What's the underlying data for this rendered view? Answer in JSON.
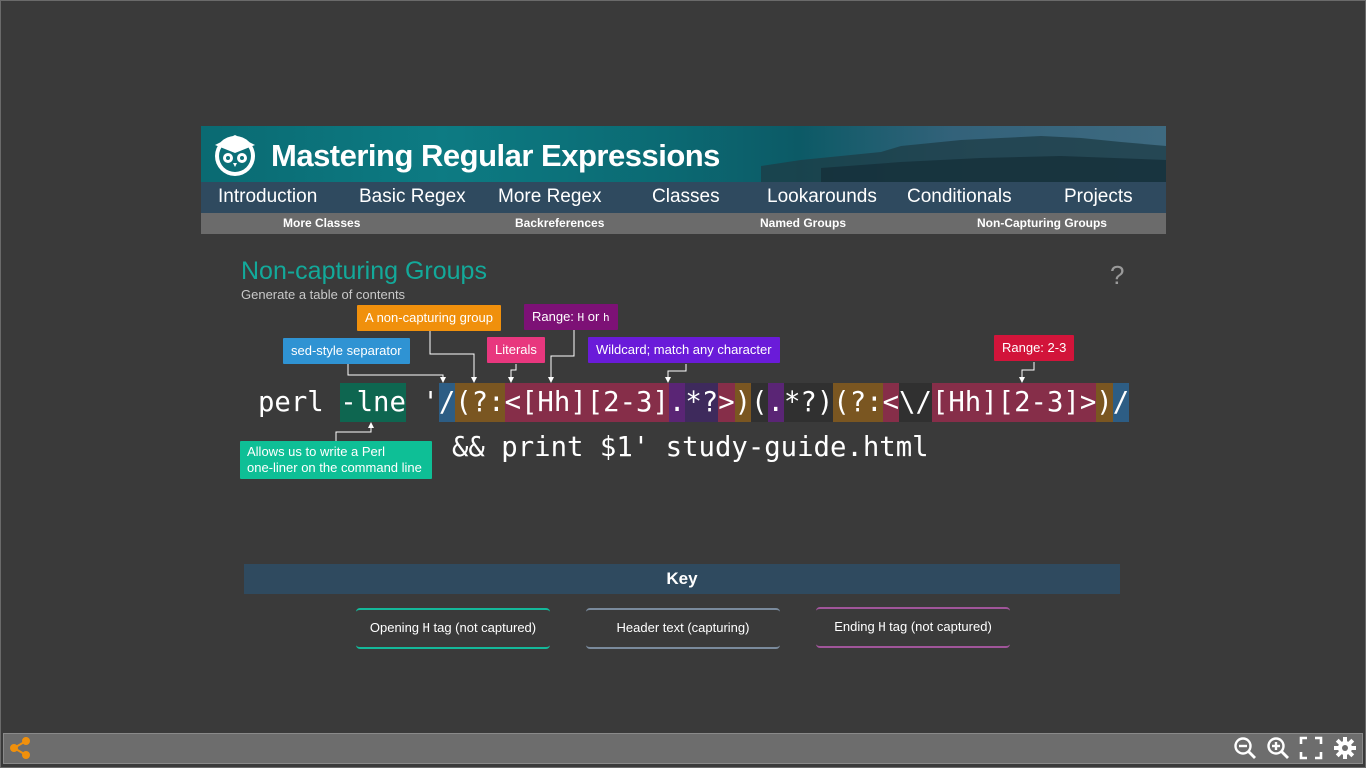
{
  "banner": {
    "title": "Mastering Regular Expressions"
  },
  "nav": {
    "items": [
      {
        "label": "Introduction"
      },
      {
        "label": "Basic Regex"
      },
      {
        "label": "More Regex"
      },
      {
        "label": "Classes"
      },
      {
        "label": "Lookarounds"
      },
      {
        "label": "Conditionals"
      },
      {
        "label": "Projects"
      }
    ],
    "subitems": [
      {
        "label": "More Classes"
      },
      {
        "label": "Backreferences"
      },
      {
        "label": "Named Groups"
      },
      {
        "label": "Non-Capturing Groups"
      }
    ]
  },
  "page": {
    "heading": "Non-capturing Groups",
    "subtitle": "Generate a table of contents",
    "help": "?"
  },
  "code": {
    "tokens": [
      "perl",
      " ",
      "-lne",
      " ",
      "'",
      "/",
      "(?:",
      "<",
      "[Hh]",
      "[2-3]",
      ".",
      "*?",
      ">",
      ")",
      "(",
      ".",
      "*?",
      ")",
      "(?:",
      "<",
      "\\/",
      "[Hh]",
      "[2-3]",
      ">",
      ")",
      "/"
    ],
    "line2": "&& print $1' study-guide.html"
  },
  "annotations": {
    "sed_separator": "sed-style separator",
    "non_capturing": "A non-capturing group",
    "literals": "Literals",
    "range_h_prefix": "Range: ",
    "range_h_1": "H",
    "range_h_or": " or ",
    "range_h_2": "h",
    "wildcard": "Wildcard; match any character",
    "range_23": "Range: 2-3",
    "lne_line1": "Allows us to write a Perl",
    "lne_line2": "one-liner on the command line"
  },
  "key": {
    "title": "Key",
    "items": [
      {
        "pre": "Opening ",
        "tag": "H",
        "post": " tag (not captured)",
        "color": "#14b89a"
      },
      {
        "pre": "Header text (capturing)",
        "tag": "",
        "post": "",
        "color": "#7a8a9c"
      },
      {
        "pre": "Ending ",
        "tag": "H",
        "post": " tag (not captured)",
        "color": "#a0559a"
      }
    ]
  },
  "colors": {
    "teal": "#13a99a",
    "orange": "#f0900c",
    "magenta_label": "#7d1176",
    "pink_label": "#e8377e",
    "violet_label": "#6a1bd9",
    "red_label": "#d2143a",
    "blue_label": "#2f93d3",
    "green_label": "#0ebf96"
  },
  "toolbar": {
    "icons": [
      "share-icon",
      "zoom-out-icon",
      "zoom-in-icon",
      "fullscreen-icon",
      "settings-icon"
    ]
  }
}
